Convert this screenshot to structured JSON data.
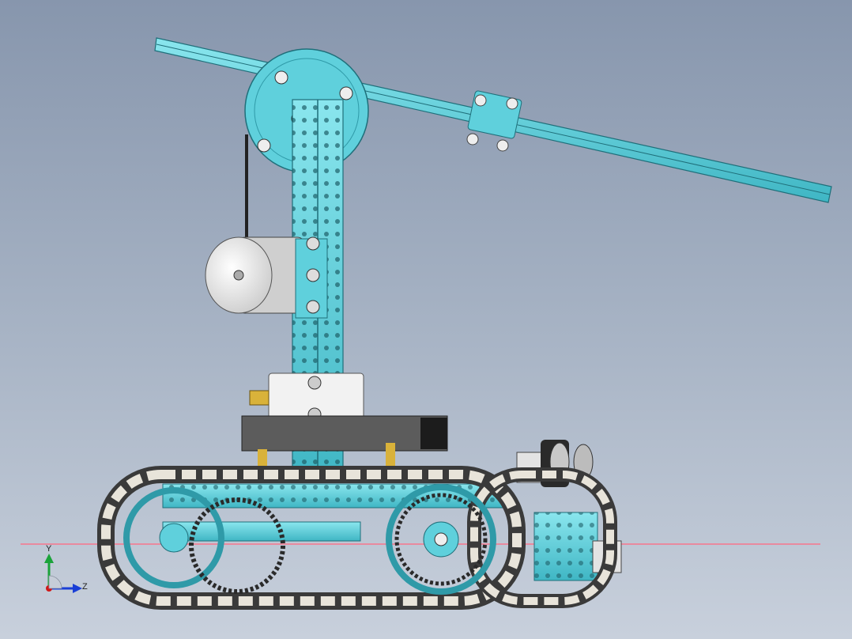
{
  "triad": {
    "y_label": "Y",
    "z_label": "Z",
    "y_color": "#1aa33a",
    "z_color": "#1a3fd6",
    "x_color": "#d01818"
  },
  "colors": {
    "part_blue": "#5fd0dc",
    "part_blue_dark": "#2f9aa8",
    "dark_grey": "#3a3a3a",
    "track_light": "#e8e4da",
    "motor_white": "#f4f4f4",
    "brass": "#d9b23a",
    "reference_line": "#e98a9e"
  }
}
